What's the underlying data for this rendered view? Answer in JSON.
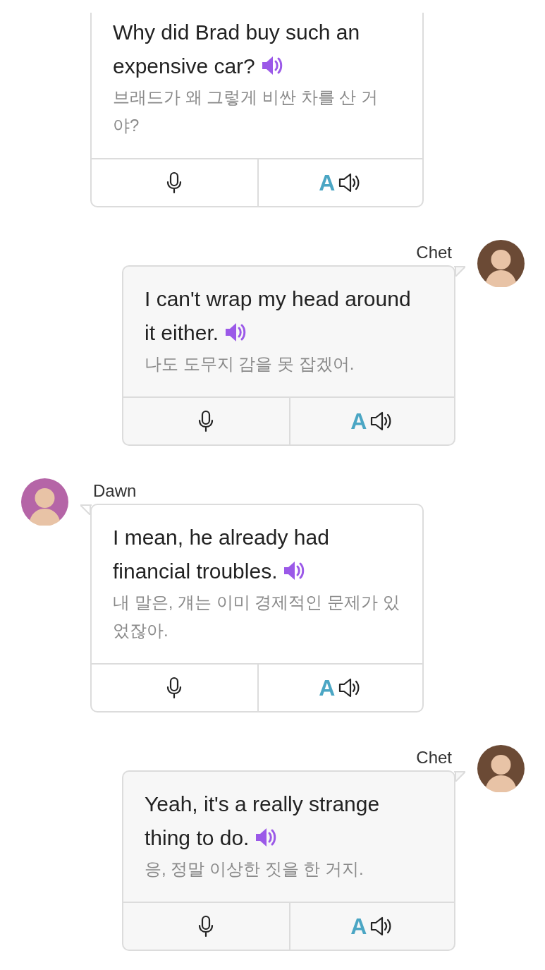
{
  "messages": [
    {
      "kind": "received",
      "text": "Why did Brad buy such an expensive car?",
      "translation": "브래드가 왜 그렇게 비싼 차를 산 거야?",
      "translate_button": "A"
    },
    {
      "kind": "sent",
      "speaker": {
        "name": "Chet",
        "color": "#6b4a35"
      },
      "text": "I can't wrap my head around it either.",
      "translation": "나도 도무지 감을 못 잡겠어.",
      "translate_button": "A"
    },
    {
      "kind": "received",
      "speaker": {
        "name": "Dawn",
        "color": "#b565a7"
      },
      "text": "I mean, he already had financial troubles.",
      "translation": "내 말은, 걔는 이미 경제적인 문제가 있었잖아.",
      "translate_button": "A"
    },
    {
      "kind": "sent",
      "speaker": {
        "name": "Chet",
        "color": "#6b4a35"
      },
      "text": "Yeah, it's a really strange thing to do.",
      "translation": "응, 정말 이상한 짓을 한 거지.",
      "translate_button": "A"
    }
  ]
}
